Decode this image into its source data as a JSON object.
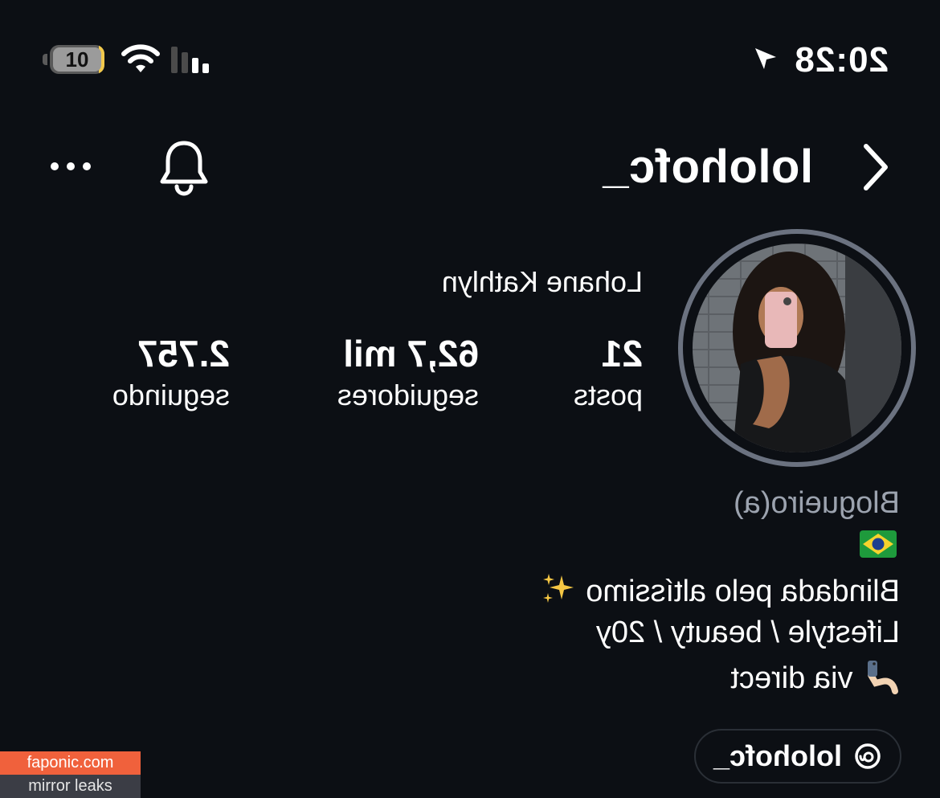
{
  "status_bar": {
    "time": "20:28",
    "battery_level": "10",
    "battery_fraction": 0.1,
    "location_icon": "location-arrow-icon",
    "wifi_icon": "wifi-icon",
    "cell_icon": "cellular-signal-icon"
  },
  "header": {
    "username": "lolohofc_",
    "back_icon": "chevron-left-icon",
    "bell_icon": "bell-icon",
    "more_icon": "more-dots-icon"
  },
  "profile": {
    "display_name": "Lohane Kathlyn",
    "stats": [
      {
        "value": "21",
        "label": "posts"
      },
      {
        "value": "62,7 mil",
        "label": "seguidores"
      },
      {
        "value": "2.757",
        "label": "seguindo"
      }
    ]
  },
  "bio": {
    "category": "Blogueiro(a)",
    "flag": "brazil-flag-icon",
    "line1": "Blindada pelo altíssimo",
    "line1_emoji": "sparkles-icon",
    "line2": "Lifestyle / beauty / 20y",
    "line3": "via direct",
    "line3_emoji": "selfie-icon"
  },
  "threads": {
    "label": "lolohofc_",
    "icon": "threads-icon"
  },
  "watermark": {
    "site": "faponic.com",
    "tagline": "mirror leaks"
  },
  "colors": {
    "background": "#0c0f14",
    "text": "#ffffff",
    "muted": "#9ca3af",
    "ring": "#6b7280",
    "battery_fill": "#f2c94c",
    "watermark_orange": "#f0613c"
  }
}
